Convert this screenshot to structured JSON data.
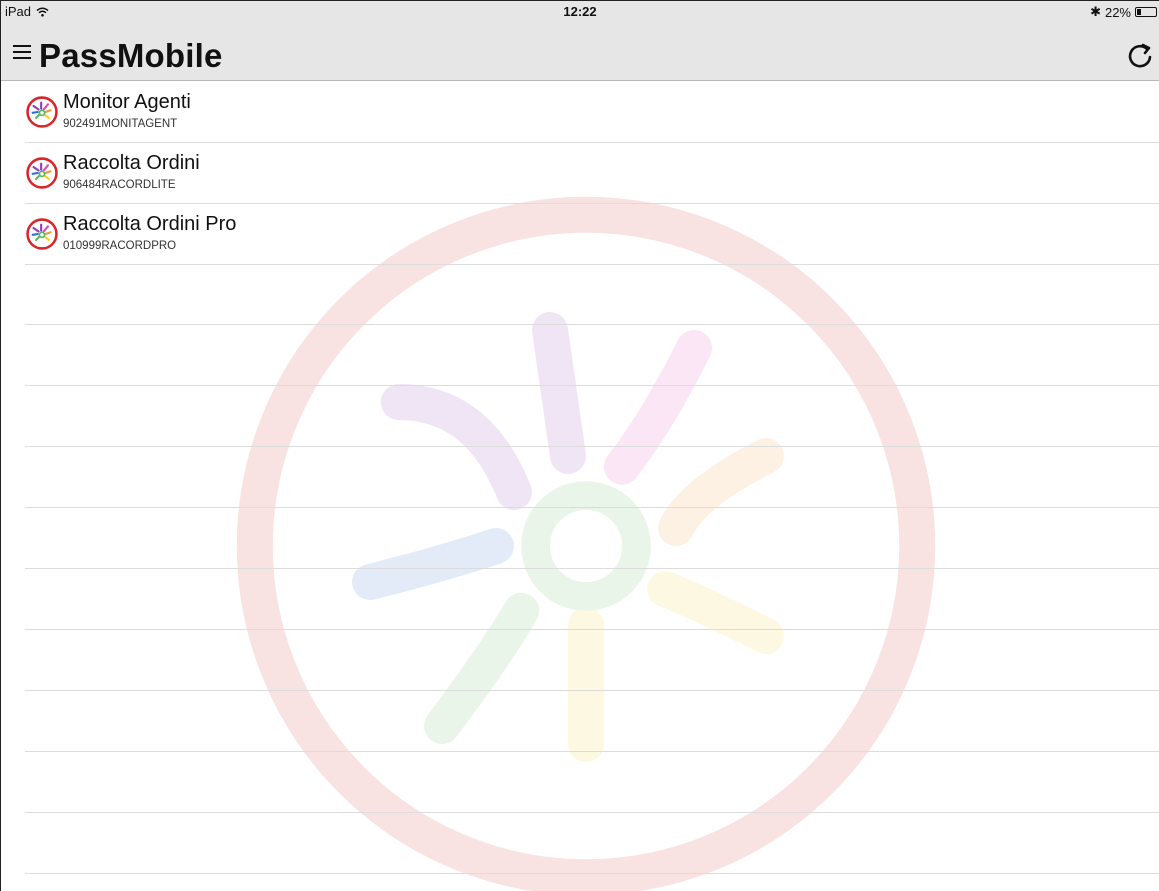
{
  "status_bar": {
    "device": "iPad",
    "time": "12:22",
    "battery_text": "22%",
    "bluetooth_glyph": "✱"
  },
  "navbar": {
    "title": "PassMobile",
    "menu_icon": "hamburger-menu-icon",
    "refresh_icon": "refresh-icon"
  },
  "apps": [
    {
      "title": "Monitor Agenti",
      "code": "902491MONITAGENT"
    },
    {
      "title": "Raccolta Ordini",
      "code": "906484RACORDLITE"
    },
    {
      "title": "Raccolta Ordini Pro",
      "code": "010999RACORDPRO"
    }
  ],
  "colors": {
    "brand_red": "#d9262b",
    "bar_bg": "#e6e6e6",
    "petal_purple": "#8e3fb5",
    "petal_pink": "#e04ab4",
    "petal_orange": "#f29a2e",
    "petal_yellow": "#f5d01f",
    "petal_green": "#5cb85c",
    "petal_blue": "#2f6fd6"
  }
}
